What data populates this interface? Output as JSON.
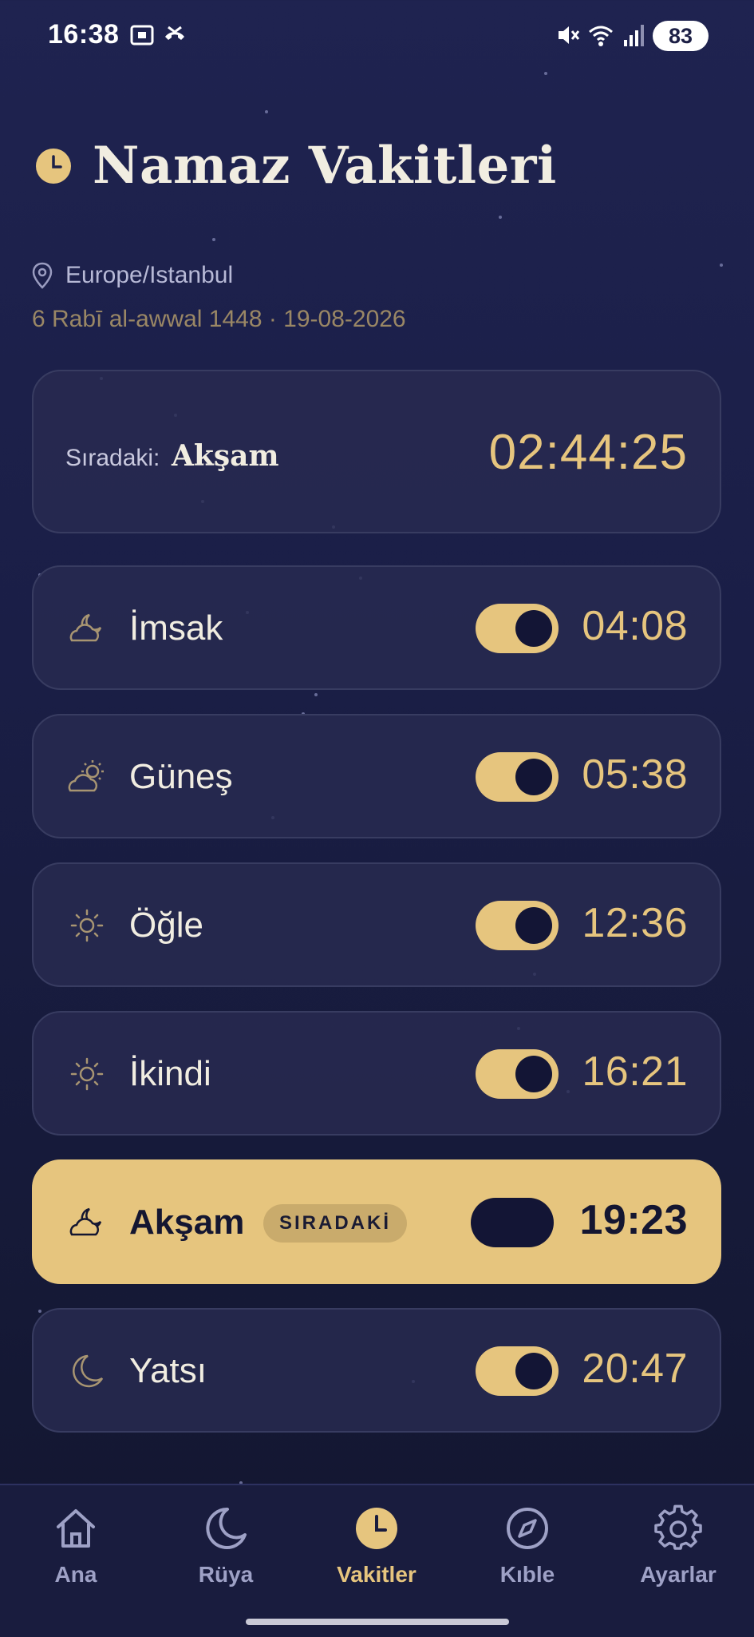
{
  "status_bar": {
    "time": "16:38",
    "battery": "83"
  },
  "header": {
    "title": "Namaz Vakitleri",
    "location": "Europe/Istanbul",
    "date": "6 Rabī al-awwal 1448 · 19-08-2026"
  },
  "next_prayer": {
    "label": "Sıradaki:",
    "name": "Akşam",
    "countdown": "02:44:25"
  },
  "prayers": [
    {
      "name": "İmsak",
      "time": "04:08",
      "icon": "cloud-moon-icon",
      "enabled": true
    },
    {
      "name": "Güneş",
      "time": "05:38",
      "icon": "cloud-sun-icon",
      "enabled": true
    },
    {
      "name": "Öğle",
      "time": "12:36",
      "icon": "sun-icon",
      "enabled": true
    },
    {
      "name": "İkindi",
      "time": "16:21",
      "icon": "sun-icon",
      "enabled": true
    },
    {
      "name": "Akşam",
      "time": "19:23",
      "icon": "cloud-moon-icon",
      "enabled": false,
      "badge": "SIRADAKİ",
      "active": true
    },
    {
      "name": "Yatsı",
      "time": "20:47",
      "icon": "moon-icon",
      "enabled": true
    }
  ],
  "nav": {
    "items": [
      {
        "label": "Ana",
        "icon": "home-icon"
      },
      {
        "label": "Rüya",
        "icon": "moon-icon"
      },
      {
        "label": "Vakitler",
        "icon": "clock-icon",
        "active": true
      },
      {
        "label": "Kıble",
        "icon": "compass-icon"
      },
      {
        "label": "Ayarlar",
        "icon": "gear-icon"
      }
    ]
  },
  "colors": {
    "accent": "#e6c57e",
    "background": "#1c2048",
    "card": "#282b50",
    "text": "#f1ede1"
  }
}
